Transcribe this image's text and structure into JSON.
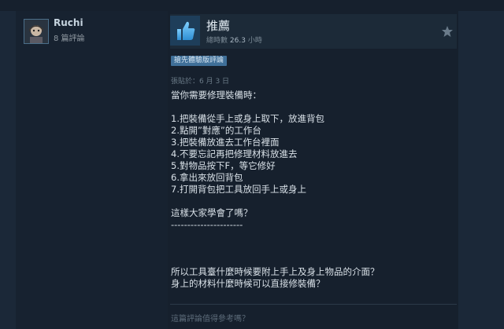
{
  "author": {
    "username": "Ruchi",
    "review_count": "8 篇評論"
  },
  "verdict": {
    "title": "推薦",
    "hours_prefix": "總時數",
    "hours_value": "26.3",
    "hours_unit": "小時",
    "icon": "thumbs-up-icon"
  },
  "badge": "搶先體驗版評論",
  "posted": "張貼於：6 月 3 日",
  "review_lines": [
    "當你需要修理裝備時：",
    "",
    "1.把裝備從手上或身上取下，放進背包",
    "2.點開”對應”的工作台",
    "3.把裝備放進去工作台裡面",
    "4.不要忘記再把修理材料放進去",
    "5.對物品按下F，等它修好",
    "6.拿出來放回背包",
    "7.打開背包把工具放回手上或身上",
    "",
    "這樣大家學會了嗎？",
    "----------------------",
    "",
    "",
    "",
    "所以工具臺什麼時候要附上手上及身上物品的介面？",
    "身上的材料什麼時候可以直接修裝備？"
  ],
  "helpful_prompt": "這篇評論值得參考嗎？",
  "colors": {
    "background": "#1b2838",
    "card": "#16202d",
    "accent": "#66c0f4",
    "badge": "#3f6f98"
  }
}
